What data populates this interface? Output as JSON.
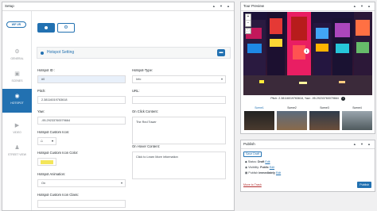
{
  "setup": {
    "title": "Setup"
  },
  "sidebar": {
    "logo": "WP VR",
    "items": [
      {
        "label": "GENERAL"
      },
      {
        "label": "SCENES"
      },
      {
        "label": "HOTSPOT"
      },
      {
        "label": "VIDEO"
      },
      {
        "label": "STREET VIEW"
      }
    ]
  },
  "hotspot_setting": {
    "title": "Hotspot Setting",
    "id_label": "Hotspot ID :",
    "id_value": "#0",
    "type_label": "Hotspot-Type:",
    "type_value": "Info",
    "pitch_label": "Pitch:",
    "pitch_value": "2.38116019763618",
    "url_label": "URL:",
    "yaw_label": "Yaw:",
    "yaw_value": "-95.29233760079664",
    "click_label": "On Click Content:",
    "click_value": "The Red Tower",
    "icon_label": "Hotspot Custom Icon:",
    "icon_color_label": "Hotspot Custom Icon Color:",
    "hover_label": "On Hover Content:",
    "hover_value": "Click to Learn More information",
    "animation_label": "Hotspot Animation:",
    "animation_value": "On",
    "icon_class_label": "Hotspot Custom Icon Class:"
  },
  "tour": {
    "title": "Tour Preview",
    "pitch_line": "Pitch: 2.38116019763618, Yaw: -95.29233760079664",
    "scenes": [
      "Scene1",
      "Scene2",
      "Scene3",
      "Scene4"
    ]
  },
  "publish": {
    "title": "Publish",
    "save_draft": "Save Draft",
    "status_label": "Status:",
    "status_value": "Draft",
    "status_edit": "Edit",
    "visibility_label": "Visibility:",
    "visibility_value": "Public",
    "visibility_edit": "Edit",
    "publish_label": "Publish",
    "publish_value": "immediately",
    "publish_edit": "Edit",
    "trash": "Move to Trash",
    "publish_button": "Publish"
  },
  "colors": {
    "accent": "#2271b1",
    "icon_color": "#f3e65a"
  }
}
